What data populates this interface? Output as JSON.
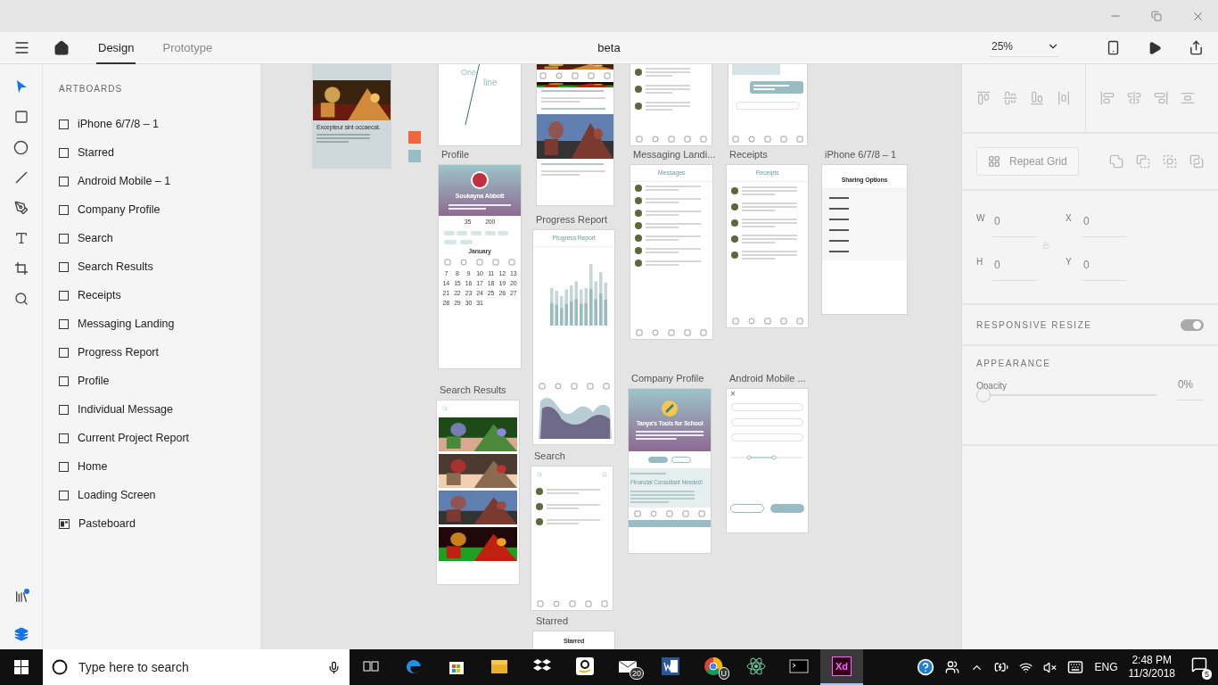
{
  "toolbar": {
    "tabs": [
      {
        "label": "Design",
        "selected": true
      },
      {
        "label": "Prototype",
        "selected": false
      }
    ],
    "document_title": "beta",
    "zoom": "25%"
  },
  "tools": [
    {
      "kind": "select",
      "selected": true
    },
    {
      "kind": "rectangle",
      "selected": false
    },
    {
      "kind": "ellipse",
      "selected": false
    },
    {
      "kind": "line",
      "selected": false
    },
    {
      "kind": "pen",
      "selected": false
    },
    {
      "kind": "text",
      "selected": false
    },
    {
      "kind": "artboard",
      "selected": false
    },
    {
      "kind": "zoom",
      "selected": false
    }
  ],
  "bottom_tools": [
    {
      "kind": "assets",
      "selected": false,
      "dot": true
    },
    {
      "kind": "layers",
      "selected": true,
      "dot": false
    }
  ],
  "layers": {
    "heading": "ARTBOARDS",
    "items": [
      {
        "label": "iPhone 6/7/8 – 1",
        "kind": "artboard"
      },
      {
        "label": "Starred",
        "kind": "artboard"
      },
      {
        "label": "Android Mobile – 1",
        "kind": "artboard"
      },
      {
        "label": "Company Profile",
        "kind": "artboard"
      },
      {
        "label": "Search",
        "kind": "artboard"
      },
      {
        "label": "Search Results",
        "kind": "artboard"
      },
      {
        "label": "Receipts",
        "kind": "artboard"
      },
      {
        "label": "Messaging Landing",
        "kind": "artboard"
      },
      {
        "label": "Progress Report",
        "kind": "artboard"
      },
      {
        "label": "Profile",
        "kind": "artboard"
      },
      {
        "label": "Individual Message",
        "kind": "artboard"
      },
      {
        "label": "Current Project Report",
        "kind": "artboard"
      },
      {
        "label": "Home",
        "kind": "artboard"
      },
      {
        "label": "Loading Screen",
        "kind": "artboard"
      },
      {
        "label": "Pasteboard",
        "kind": "pasteboard"
      }
    ]
  },
  "swatches": [
    {
      "color": "#f0663a"
    },
    {
      "color": "#97bdc2"
    }
  ],
  "artboards": [
    {
      "kind": "feed_card",
      "heading": "Excepteur sint occaecat."
    },
    {
      "kind": "logo",
      "word_1": "One",
      "word_2": "line"
    },
    {
      "kind": "feed"
    },
    {
      "kind": "list_partial"
    },
    {
      "kind": "chat_partial"
    },
    {
      "kind": "profile",
      "title": "Profile",
      "name": "Soukayna Abbott",
      "stat_1": "35",
      "stat_2": "200",
      "month": "January",
      "weeks": [
        [
          "7",
          "8",
          "9",
          "10",
          "11",
          "12",
          "13"
        ],
        [
          "14",
          "15",
          "16",
          "17",
          "18",
          "19",
          "20"
        ],
        [
          "21",
          "22",
          "23",
          "24",
          "25",
          "26",
          "27"
        ],
        [
          "28",
          "29",
          "30",
          "31"
        ]
      ]
    },
    {
      "kind": "progress",
      "title": "Progress Report",
      "heading": "Progress Report"
    },
    {
      "kind": "messages",
      "title": "Messaging Landi...",
      "heading": "Messages"
    },
    {
      "kind": "receipts",
      "title": "Receipts",
      "heading": "Receipts"
    },
    {
      "kind": "sharing",
      "title": "iPhone 6/7/8 – 1",
      "heading": "Sharing Options"
    },
    {
      "kind": "search_results",
      "title": "Search Results"
    },
    {
      "kind": "search",
      "title": "Search"
    },
    {
      "kind": "starred",
      "title": "Starred",
      "heading": "Starred"
    },
    {
      "kind": "company",
      "title": "Company Profile",
      "name": "Tanya's Tools for School",
      "job": "Financial Consultant Needed!"
    },
    {
      "kind": "android",
      "title": "Android Mobile ...",
      "close": "×"
    }
  ],
  "inspector": {
    "align_buttons": [
      {
        "kind": "top"
      },
      {
        "kind": "middle"
      },
      {
        "kind": "bottom"
      },
      {
        "kind": "distribute_v"
      },
      {
        "kind": "left"
      },
      {
        "kind": "center"
      },
      {
        "kind": "right"
      },
      {
        "kind": "distribute_h"
      }
    ],
    "repeat_grid": "Repeat Grid",
    "boolean_buttons": [
      {
        "kind": "add"
      },
      {
        "kind": "subtract"
      },
      {
        "kind": "intersect"
      },
      {
        "kind": "exclude"
      }
    ],
    "fields": [
      {
        "label": "W",
        "value": "0"
      },
      {
        "label": "X",
        "value": "0"
      },
      {
        "label": "H",
        "value": "0"
      },
      {
        "label": "Y",
        "value": "0"
      }
    ],
    "responsive": {
      "label": "RESPONSIVE RESIZE",
      "on": true
    },
    "appearance": "APPEARANCE",
    "opacity": {
      "label": "Opacity",
      "level": 0,
      "reading": "0%"
    }
  },
  "taskbar": {
    "search": {
      "placeholder": "Type here to search"
    },
    "apps": [
      {
        "kind": "task_view",
        "selected": false
      },
      {
        "kind": "edge",
        "selected": false
      },
      {
        "kind": "store",
        "selected": false
      },
      {
        "kind": "explorer",
        "selected": false
      },
      {
        "kind": "dropbox",
        "selected": false
      },
      {
        "kind": "amazon",
        "selected": false
      },
      {
        "kind": "mail",
        "selected": false,
        "badge": "20"
      },
      {
        "kind": "word",
        "selected": false
      },
      {
        "kind": "chrome",
        "selected": false,
        "badge": "U"
      },
      {
        "kind": "atom",
        "selected": false
      },
      {
        "kind": "terminal",
        "selected": false
      },
      {
        "kind": "xd",
        "selected": true,
        "label": "Xd"
      }
    ],
    "language": "ENG",
    "time": "2:48 PM",
    "date": "11/3/2018",
    "notifications": "5"
  }
}
